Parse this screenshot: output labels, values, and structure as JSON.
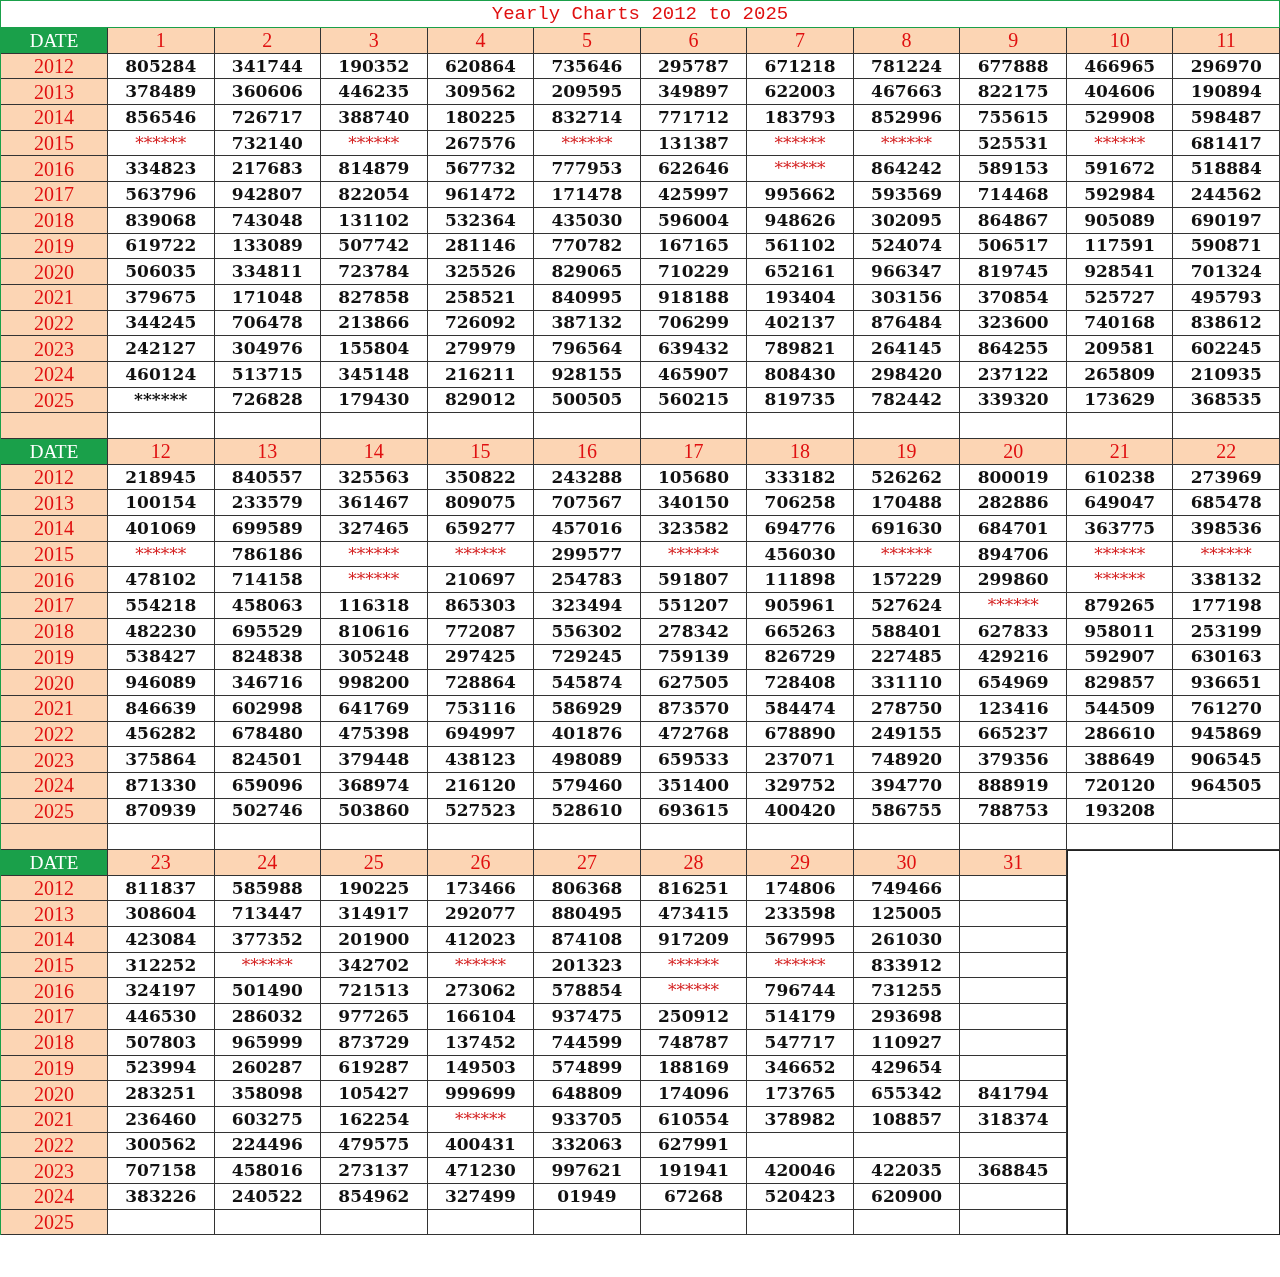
{
  "title": "Yearly Charts 2012 to 2025",
  "blocks": [
    {
      "header": "DATE",
      "days": [
        "1",
        "2",
        "3",
        "4",
        "5",
        "6",
        "7",
        "8",
        "9",
        "10",
        "11"
      ],
      "spacer_row": true,
      "rows": [
        {
          "year": "2012",
          "cells": [
            "805284",
            "341744",
            "190352",
            "620864",
            "735646",
            "295787",
            "671218",
            "781224",
            "677888",
            "466965",
            "296970"
          ]
        },
        {
          "year": "2013",
          "cells": [
            "378489",
            "360606",
            "446235",
            "309562",
            "209595",
            "349897",
            "622003",
            "467663",
            "822175",
            "404606",
            "190894"
          ]
        },
        {
          "year": "2014",
          "cells": [
            "856546",
            "726717",
            "388740",
            "180225",
            "832714",
            "771712",
            "183793",
            "852996",
            "755615",
            "529908",
            "598487"
          ]
        },
        {
          "year": "2015",
          "cells": [
            {
              "text": "******",
              "color": "#d42020"
            },
            "732140",
            {
              "text": "******",
              "color": "#d42020"
            },
            "267576",
            {
              "text": "******",
              "color": "#d42020"
            },
            "131387",
            {
              "text": "******",
              "color": "#d42020"
            },
            {
              "text": "******",
              "color": "#d42020"
            },
            "525531",
            {
              "text": "******",
              "color": "#d42020"
            },
            "681417"
          ]
        },
        {
          "year": "2016",
          "cells": [
            "334823",
            "217683",
            "814879",
            "567732",
            "777953",
            "622646",
            {
              "text": "******",
              "color": "#d42020"
            },
            "864242",
            "589153",
            "591672",
            "518884"
          ]
        },
        {
          "year": "2017",
          "cells": [
            "563796",
            "942807",
            "822054",
            "961472",
            "171478",
            "425997",
            "995662",
            "593569",
            "714468",
            "592984",
            "244562"
          ]
        },
        {
          "year": "2018",
          "cells": [
            "839068",
            "743048",
            "131102",
            "532364",
            "435030",
            "596004",
            "948626",
            "302095",
            "864867",
            "905089",
            "690197"
          ]
        },
        {
          "year": "2019",
          "cells": [
            "619722",
            "133089",
            "507742",
            "281146",
            "770782",
            "167165",
            "561102",
            "524074",
            "506517",
            "117591",
            "590871"
          ]
        },
        {
          "year": "2020",
          "cells": [
            "506035",
            "334811",
            "723784",
            "325526",
            "829065",
            "710229",
            "652161",
            "966347",
            "819745",
            "928541",
            "701324"
          ]
        },
        {
          "year": "2021",
          "cells": [
            "379675",
            "171048",
            "827858",
            "258521",
            "840995",
            "918188",
            "193404",
            "303156",
            "370854",
            "525727",
            "495793"
          ]
        },
        {
          "year": "2022",
          "cells": [
            "344245",
            "706478",
            "213866",
            "726092",
            "387132",
            "706299",
            "402137",
            "876484",
            "323600",
            "740168",
            "838612"
          ]
        },
        {
          "year": "2023",
          "cells": [
            "242127",
            "304976",
            "155804",
            "279979",
            "796564",
            "639432",
            "789821",
            "264145",
            "864255",
            "209581",
            "602245"
          ]
        },
        {
          "year": "2024",
          "cells": [
            "460124",
            "513715",
            "345148",
            "216211",
            "928155",
            "465907",
            "808430",
            "298420",
            "237122",
            "265809",
            "210935"
          ]
        },
        {
          "year": "2025",
          "cells": [
            "******",
            "726828",
            "179430",
            "829012",
            "500505",
            "560215",
            "819735",
            "782442",
            "339320",
            "173629",
            "368535"
          ]
        }
      ]
    },
    {
      "header": "DATE",
      "days": [
        "12",
        "13",
        "14",
        "15",
        "16",
        "17",
        "18",
        "19",
        "20",
        "21",
        "22"
      ],
      "spacer_row": true,
      "rows": [
        {
          "year": "2012",
          "cells": [
            "218945",
            "840557",
            "325563",
            "350822",
            "243288",
            "105680",
            "333182",
            "526262",
            "800019",
            "610238",
            "273969"
          ]
        },
        {
          "year": "2013",
          "cells": [
            "100154",
            "233579",
            "361467",
            "809075",
            "707567",
            "340150",
            "706258",
            "170488",
            "282886",
            "649047",
            "685478"
          ]
        },
        {
          "year": "2014",
          "cells": [
            "401069",
            "699589",
            "327465",
            "659277",
            "457016",
            "323582",
            "694776",
            "691630",
            "684701",
            "363775",
            "398536"
          ]
        },
        {
          "year": "2015",
          "cells": [
            {
              "text": "******",
              "color": "#d42020"
            },
            "786186",
            {
              "text": "******",
              "color": "#d42020"
            },
            {
              "text": "******",
              "color": "#d42020"
            },
            "299577",
            {
              "text": "******",
              "color": "#d42020"
            },
            "456030",
            {
              "text": "******",
              "color": "#d42020"
            },
            "894706",
            {
              "text": "******",
              "color": "#d42020"
            },
            {
              "text": "******",
              "color": "#d42020"
            }
          ]
        },
        {
          "year": "2016",
          "cells": [
            "478102",
            "714158",
            {
              "text": "******",
              "color": "#d42020"
            },
            "210697",
            "254783",
            "591807",
            "111898",
            "157229",
            "299860",
            {
              "text": "******",
              "color": "#d42020"
            },
            "338132"
          ]
        },
        {
          "year": "2017",
          "cells": [
            "554218",
            "458063",
            "116318",
            "865303",
            "323494",
            "551207",
            "905961",
            "527624",
            {
              "text": "******",
              "color": "#d42020"
            },
            "879265",
            "177198"
          ]
        },
        {
          "year": "2018",
          "cells": [
            "482230",
            "695529",
            "810616",
            "772087",
            "556302",
            "278342",
            "665263",
            "588401",
            "627833",
            "958011",
            "253199"
          ]
        },
        {
          "year": "2019",
          "cells": [
            "538427",
            "824838",
            "305248",
            "297425",
            "729245",
            "759139",
            "826729",
            "227485",
            "429216",
            "592907",
            "630163"
          ]
        },
        {
          "year": "2020",
          "cells": [
            "946089",
            "346716",
            "998200",
            "728864",
            "545874",
            "627505",
            "728408",
            "331110",
            "654969",
            "829857",
            "936651"
          ]
        },
        {
          "year": "2021",
          "cells": [
            "846639",
            "602998",
            "641769",
            "753116",
            "586929",
            "873570",
            "584474",
            "278750",
            "123416",
            "544509",
            "761270"
          ]
        },
        {
          "year": "2022",
          "cells": [
            "456282",
            "678480",
            "475398",
            "694997",
            "401876",
            "472768",
            "678890",
            "249155",
            "665237",
            "286610",
            "945869"
          ]
        },
        {
          "year": "2023",
          "cells": [
            "375864",
            "824501",
            "379448",
            "438123",
            "498089",
            "659533",
            "237071",
            "748920",
            "379356",
            "388649",
            "906545"
          ]
        },
        {
          "year": "2024",
          "cells": [
            "871330",
            "659096",
            "368974",
            "216120",
            "579460",
            "351400",
            "329752",
            "394770",
            "888919",
            "720120",
            "964505"
          ]
        },
        {
          "year": "2025",
          "cells": [
            "870939",
            "502746",
            "503860",
            "527523",
            "528610",
            "693615",
            "400420",
            "586755",
            "788753",
            "193208",
            null
          ]
        }
      ]
    },
    {
      "header": "DATE",
      "days": [
        "23",
        "24",
        "25",
        "26",
        "27",
        "28",
        "29",
        "30",
        "31"
      ],
      "side_panel": true,
      "rows": [
        {
          "year": "2012",
          "cells": [
            "811837",
            "585988",
            "190225",
            "173466",
            "806368",
            "816251",
            "174806",
            "749466",
            null
          ]
        },
        {
          "year": "2013",
          "cells": [
            "308604",
            "713447",
            "314917",
            "292077",
            "880495",
            "473415",
            "233598",
            "125005",
            null
          ]
        },
        {
          "year": "2014",
          "cells": [
            "423084",
            "377352",
            "201900",
            "412023",
            "874108",
            "917209",
            "567995",
            "261030",
            null
          ]
        },
        {
          "year": "2015",
          "cells": [
            "312252",
            {
              "text": "******",
              "color": "#d42020"
            },
            "342702",
            {
              "text": "******",
              "color": "#d42020"
            },
            "201323",
            {
              "text": "******",
              "color": "#d42020"
            },
            {
              "text": "******",
              "color": "#d42020"
            },
            "833912",
            null
          ]
        },
        {
          "year": "2016",
          "cells": [
            "324197",
            "501490",
            "721513",
            "273062",
            "578854",
            {
              "text": "******",
              "color": "#d42020"
            },
            "796744",
            "731255",
            null
          ]
        },
        {
          "year": "2017",
          "cells": [
            "446530",
            "286032",
            "977265",
            "166104",
            "937475",
            "250912",
            "514179",
            "293698",
            null
          ]
        },
        {
          "year": "2018",
          "cells": [
            "507803",
            "965999",
            "873729",
            "137452",
            "744599",
            "748787",
            "547717",
            "110927",
            null
          ]
        },
        {
          "year": "2019",
          "cells": [
            "523994",
            "260287",
            "619287",
            "149503",
            "574899",
            "188169",
            "346652",
            "429654",
            null
          ]
        },
        {
          "year": "2020",
          "cells": [
            "283251",
            "358098",
            "105427",
            "999699",
            "648809",
            "174096",
            "173765",
            "655342",
            "841794"
          ]
        },
        {
          "year": "2021",
          "cells": [
            "236460",
            "603275",
            "162254",
            {
              "text": "******",
              "color": "#d42020"
            },
            "933705",
            "610554",
            "378982",
            "108857",
            "318374"
          ]
        },
        {
          "year": "2022",
          "cells": [
            "300562",
            "224496",
            "479575",
            "400431",
            "332063",
            "627991",
            null,
            null,
            null
          ]
        },
        {
          "year": "2023",
          "cells": [
            "707158",
            "458016",
            "273137",
            "471230",
            "997621",
            "191941",
            "420046",
            "422035",
            "368845"
          ]
        },
        {
          "year": "2024",
          "cells": [
            "383226",
            "240522",
            "854962",
            "327499",
            "01949",
            "67268",
            "520423",
            "620900",
            null
          ]
        },
        {
          "year": "2025",
          "cells": [
            null,
            null,
            null,
            null,
            null,
            null,
            null,
            null,
            null
          ]
        }
      ]
    }
  ]
}
